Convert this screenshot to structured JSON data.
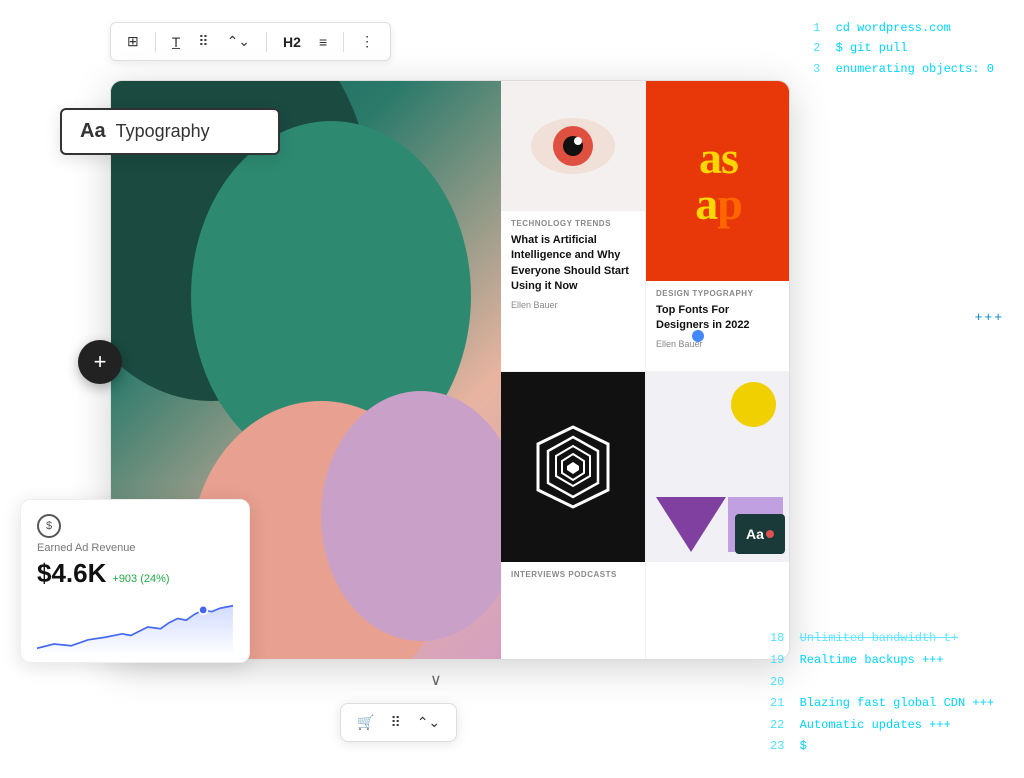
{
  "toolbar": {
    "h2_label": "H2",
    "more_icon": "⋮"
  },
  "terminal_top": {
    "lines": [
      {
        "num": "1",
        "text": "cd wordpress.com"
      },
      {
        "num": "2",
        "text": "$ git pull"
      },
      {
        "num": "3",
        "text": "enumerating objects: 0"
      }
    ]
  },
  "terminal_bottom": {
    "lines": [
      {
        "num": "18",
        "text": "Unlimited bandwidth t+",
        "strikethrough": true
      },
      {
        "num": "19",
        "text": "Realtime backups +++"
      },
      {
        "num": "20",
        "text": ""
      },
      {
        "num": "21",
        "text": "Blazing fast global CDN +++"
      },
      {
        "num": "22",
        "text": "Automatic updates +++"
      },
      {
        "num": "23",
        "text": "$"
      }
    ]
  },
  "typography_card": {
    "aa_label": "Aa",
    "text": "Typography"
  },
  "articles": {
    "eye_article": {
      "tags": "TECHNOLOGY  TRENDS",
      "title": "What is Artificial Intelligence and Why Everyone Should Start Using it Now",
      "author": "Ellen Bauer"
    },
    "asap_article": {
      "top_text": "as",
      "bottom_text": "a",
      "bottom_p": "p",
      "tags": "DESIGN  TYPOGRAPHY",
      "title": "Top Fonts For Designers in 2022",
      "author": "Ellen Bauer"
    },
    "hex_article": {
      "tags": "INTERVIEWS  PODCASTS",
      "title": ""
    },
    "aa_article": {
      "aa_label": "Aa"
    }
  },
  "revenue_card": {
    "icon": "$",
    "label": "Earned Ad Revenue",
    "amount": "$4.6K",
    "change": "+903 (24%)"
  },
  "add_button": {
    "label": "+"
  },
  "plus_dots": "+++"
}
